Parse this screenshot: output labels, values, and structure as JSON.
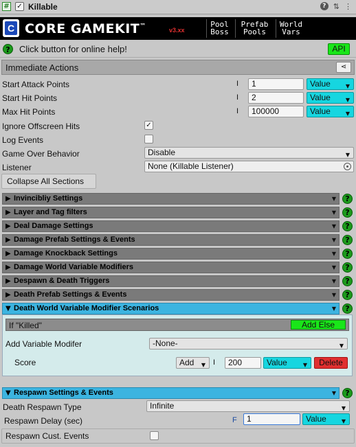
{
  "header": {
    "script_glyph": "#",
    "enabled_mark": "✓",
    "title": "Killable",
    "icons": [
      "help-icon",
      "preset-icon",
      "more-icon"
    ]
  },
  "banner": {
    "logo_text": "CORE GAMEKIT",
    "logo_mark": "™",
    "version": "v3.xx",
    "nav": [
      {
        "line1": "Pool",
        "line2": "Boss"
      },
      {
        "line1": "Prefab",
        "line2": "Pools"
      },
      {
        "line1": "World",
        "line2": "Vars"
      }
    ]
  },
  "help": {
    "text": "Click button for online help!",
    "api_label": "API",
    "q": "?"
  },
  "immediate": {
    "title": "Immediate Actions"
  },
  "fields": {
    "start_attack": {
      "label": "Start Attack Points",
      "marker": "I",
      "value": "1",
      "mode": "Value"
    },
    "start_hit": {
      "label": "Start Hit Points",
      "marker": "I",
      "value": "2",
      "mode": "Value"
    },
    "max_hit": {
      "label": "Max Hit Points",
      "marker": "I",
      "value": "100000",
      "mode": "Value"
    },
    "ignore_offscreen": {
      "label": "Ignore Offscreen Hits",
      "checked": "✓"
    },
    "log_events": {
      "label": "Log Events",
      "checked": ""
    },
    "game_over": {
      "label": "Game Over Behavior",
      "value": "Disable"
    },
    "listener": {
      "label": "Listener",
      "value": "None (Killable Listener)"
    }
  },
  "collapse_label": "Collapse All Sections",
  "sections": [
    "Invincibliy Settings",
    "Layer and Tag filters",
    "Deal Damage Settings",
    "Damage Prefab Settings & Events",
    "Damage Knockback Settings",
    "Damage World Variable Modifiers",
    "Despawn & Death Triggers",
    "Death Prefab Settings & Events"
  ],
  "death_world": {
    "title": "Death World Variable Modifier Scenarios",
    "if_label": "If \"Killed\"",
    "add_else": "Add Else",
    "add_modifier_label": "Add Variable Modifer",
    "add_modifier_value": "-None-",
    "score_label": "Score",
    "score_op": "Add",
    "score_marker": "I",
    "score_value": "200",
    "score_mode": "Value",
    "delete_label": "Delete"
  },
  "respawn": {
    "title": "Respawn Settings & Events",
    "type_label": "Death Respawn Type",
    "type_value": "Infinite",
    "delay_label": "Respawn Delay (sec)",
    "delay_marker": "F",
    "delay_value": "1",
    "delay_mode": "Value",
    "cust_label": "Respawn Cust. Events"
  },
  "colors": {
    "green": "#19e619",
    "cyan": "#16d6e0",
    "blue_header": "#3cb4e0",
    "red": "#e03030"
  }
}
